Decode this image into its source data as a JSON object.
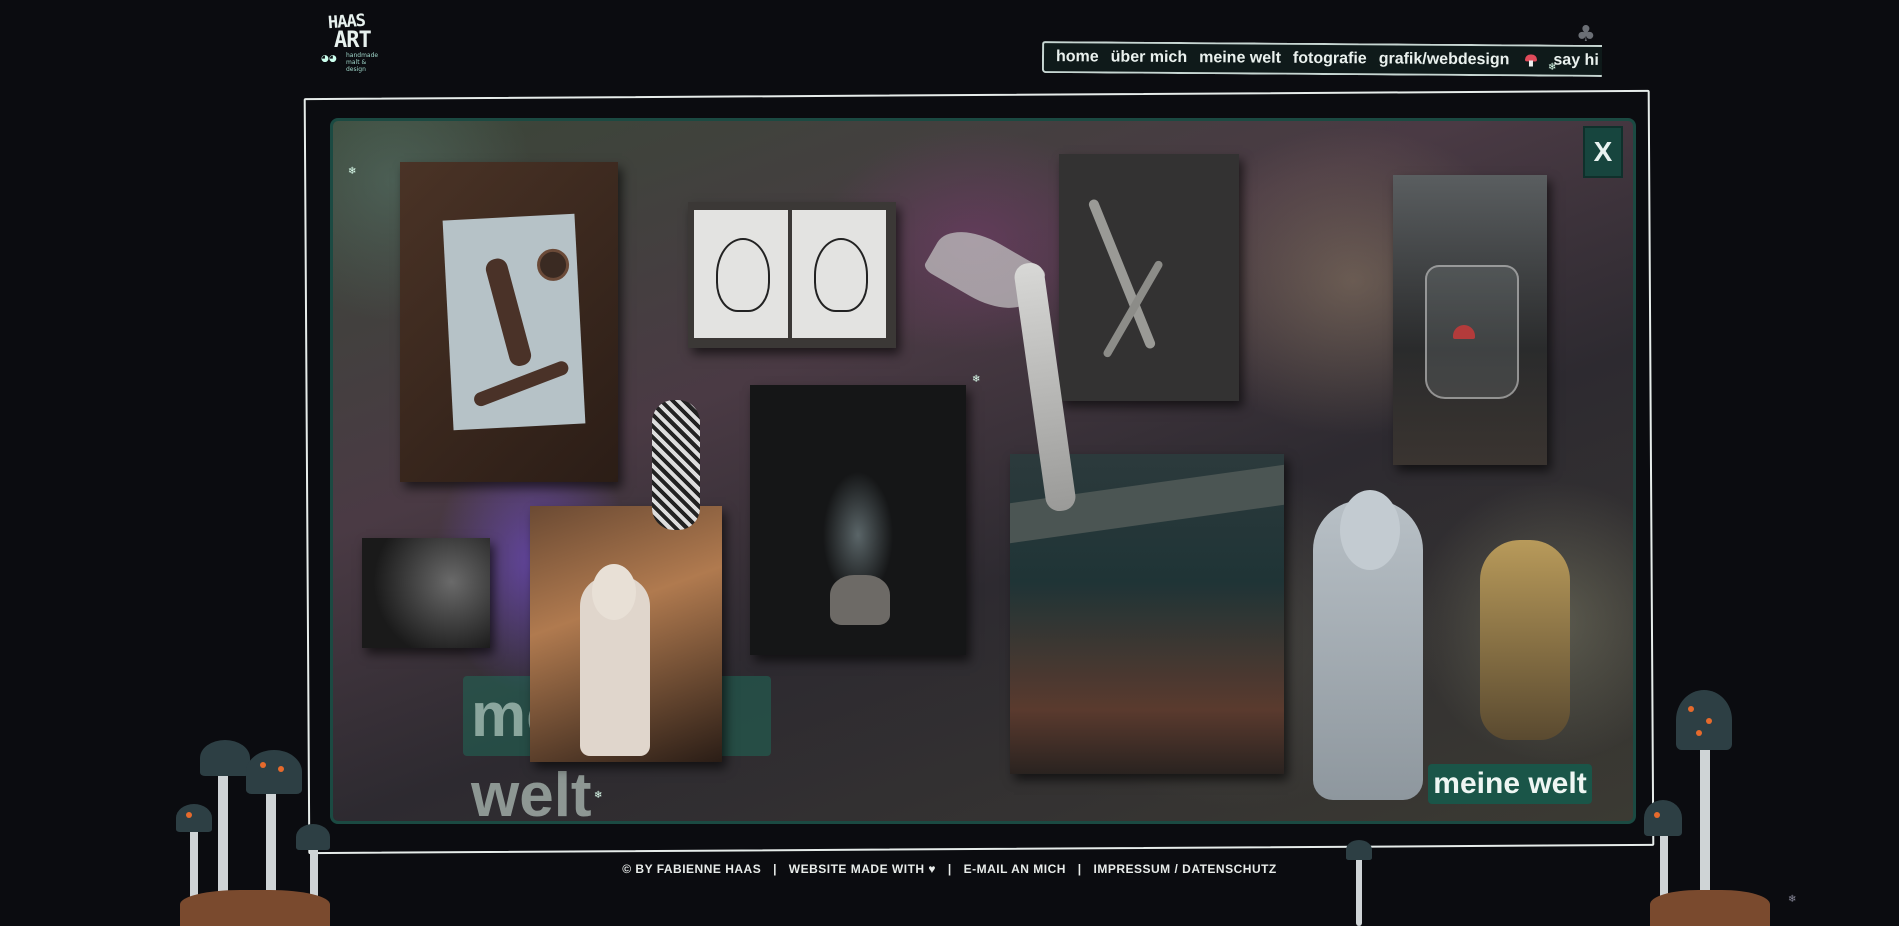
{
  "logo": {
    "line1": "HAAS",
    "line2": "ART",
    "tagline": "handmade\nmalt & design"
  },
  "nav": {
    "items": [
      "home",
      "über mich",
      "meine welt",
      "fotografie",
      "grafik/webdesign"
    ],
    "say_hi": "say hi"
  },
  "modal": {
    "close_label": "X",
    "ghost_title": "meine welt",
    "caption": "meine welt"
  },
  "footer": {
    "copyright": "© BY FABIENNE HAAS",
    "made_with": "WEBSITE MADE WITH ♥",
    "email": "E-MAIL AN MICH",
    "impressum": "IMPRESSUM / DATENSCHUTZ",
    "separator": "|"
  },
  "colors": {
    "background": "#0b0c10",
    "accent": "#1a5548",
    "nav_bg": "#0f1a1a"
  }
}
